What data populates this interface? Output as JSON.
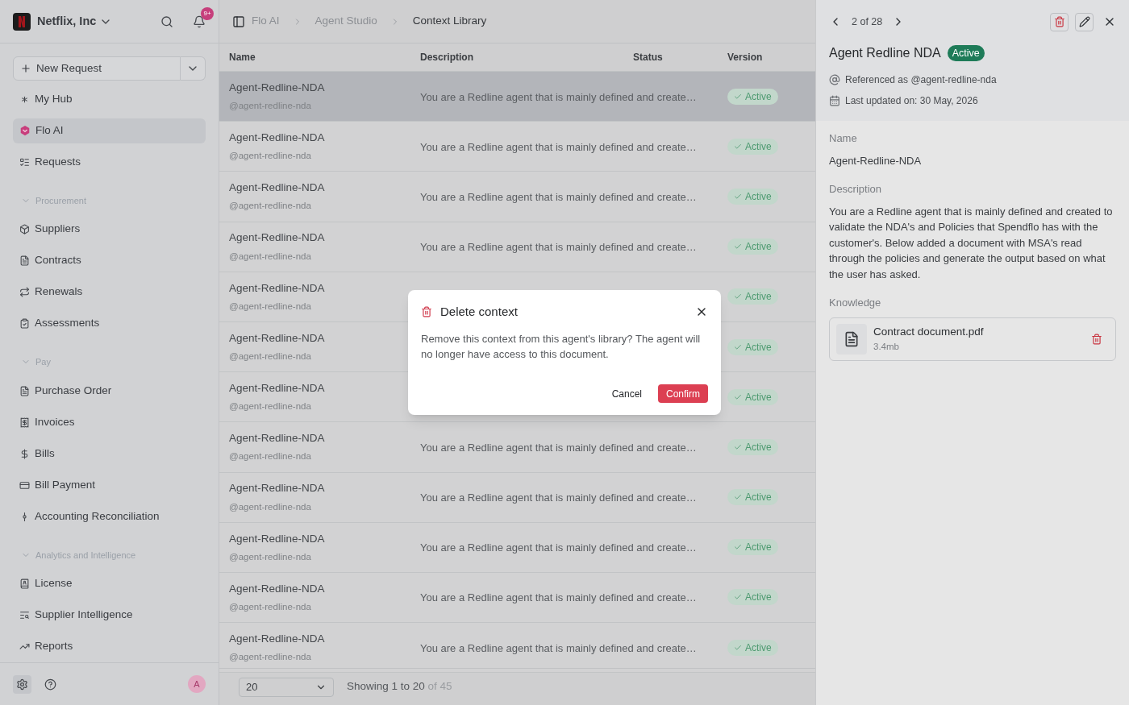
{
  "org": {
    "name": "Netflix, Inc",
    "badge": "9+"
  },
  "new_request": {
    "label": "New Request"
  },
  "nav": [
    {
      "kind": "item",
      "label": "My Hub",
      "selected": false
    },
    {
      "kind": "item",
      "label": "Flo AI",
      "selected": true
    },
    {
      "kind": "item",
      "label": "Requests",
      "selected": false
    },
    {
      "kind": "section",
      "label": "Procurement",
      "expanded": true
    },
    {
      "kind": "item",
      "label": "Suppliers",
      "selected": false
    },
    {
      "kind": "item",
      "label": "Contracts",
      "selected": false
    },
    {
      "kind": "item",
      "label": "Renewals",
      "selected": false
    },
    {
      "kind": "item",
      "label": "Assessments",
      "selected": false
    },
    {
      "kind": "section",
      "label": "Pay",
      "expanded": true
    },
    {
      "kind": "item",
      "label": "Purchase Order",
      "selected": false
    },
    {
      "kind": "item",
      "label": "Invoices",
      "selected": false
    },
    {
      "kind": "item",
      "label": "Bills",
      "selected": false
    },
    {
      "kind": "item",
      "label": "Bill Payment",
      "selected": false
    },
    {
      "kind": "item",
      "label": "Accounting Reconciliation",
      "selected": false
    },
    {
      "kind": "section",
      "label": "Analytics and Intelligence",
      "expanded": true
    },
    {
      "kind": "item",
      "label": "License",
      "selected": false
    },
    {
      "kind": "item",
      "label": "Supplier Intelligence",
      "selected": false
    },
    {
      "kind": "item",
      "label": "Reports",
      "selected": false
    }
  ],
  "footer": {
    "avatar": "A"
  },
  "breadcrumb": [
    "Flo AI",
    "Agent Studio",
    "Context Library"
  ],
  "table": {
    "columns": [
      "Name",
      "Description",
      "Status",
      "Version"
    ],
    "rows": [
      {
        "name": "Agent-Redline-NDA",
        "handle": "@agent-redline-nda",
        "description": "You are a Redline agent that is mainly defined and create…",
        "status": "Active",
        "selected": true
      },
      {
        "name": "Agent-Redline-NDA",
        "handle": "@agent-redline-nda",
        "description": "You are a Redline agent that is mainly defined and create…",
        "status": "Active",
        "selected": false
      },
      {
        "name": "Agent-Redline-NDA",
        "handle": "@agent-redline-nda",
        "description": "You are a Redline agent that is mainly defined and create…",
        "status": "Active",
        "selected": false
      },
      {
        "name": "Agent-Redline-NDA",
        "handle": "@agent-redline-nda",
        "description": "You are a Redline agent that is mainly defined and create…",
        "status": "Active",
        "selected": false
      },
      {
        "name": "Agent-Redline-NDA",
        "handle": "@agent-redline-nda",
        "status": "Active",
        "selected": false
      },
      {
        "name": "Agent-Redline-NDA",
        "handle": "@agent-redline-nda",
        "status": "Active",
        "selected": false
      },
      {
        "name": "Agent-Redline-NDA",
        "handle": "@agent-redline-nda",
        "status": "Active",
        "selected": false
      },
      {
        "name": "Agent-Redline-NDA",
        "handle": "@agent-redline-nda",
        "description": "You are a Redline agent that is mainly defined and create…",
        "status": "Active",
        "selected": false
      },
      {
        "name": "Agent-Redline-NDA",
        "handle": "@agent-redline-nda",
        "description": "You are a Redline agent that is mainly defined and create…",
        "status": "Active",
        "selected": false
      },
      {
        "name": "Agent-Redline-NDA",
        "handle": "@agent-redline-nda",
        "description": "You are a Redline agent that is mainly defined and create…",
        "status": "Active",
        "selected": false
      },
      {
        "name": "Agent-Redline-NDA",
        "handle": "@agent-redline-nda",
        "description": "You are a Redline agent that is mainly defined and create…",
        "status": "Active",
        "selected": false
      },
      {
        "name": "Agent-Redline-NDA",
        "handle": "@agent-redline-nda",
        "description": "You are a Redline agent that is mainly defined and create…",
        "status": "Active",
        "selected": false
      }
    ]
  },
  "pagination": {
    "page_size": "20",
    "showing": "Showing 1 to 20",
    "total": "of 45"
  },
  "detail": {
    "pager": "2 of 28",
    "title": "Agent Redline NDA",
    "status": "Active",
    "referenced": "Referenced as @agent-redline-nda",
    "updated": "Last updated on: 30 May, 2026",
    "fields": [
      {
        "label": "Name",
        "value": "Agent-Redline-NDA"
      },
      {
        "label": "Description",
        "value": "You are a Redline agent that is mainly defined and created to validate the NDA's and Policies that Spendflo has with the customer's. Below added a document with MSA's read through the policies and generate the output based on what the user has asked."
      }
    ],
    "knowledge": {
      "label": "Knowledge",
      "file": "Contract document.pdf",
      "size": "3.4mb"
    }
  },
  "dialog": {
    "title": "Delete context",
    "body": "Remove this context from this agent's library? The agent will no longer have access to this document.",
    "cancel": "Cancel",
    "confirm": "Confirm"
  }
}
